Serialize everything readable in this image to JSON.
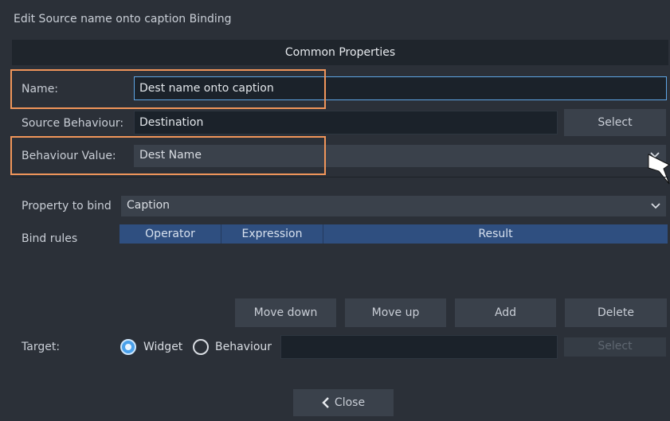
{
  "window": {
    "title": "Edit Source name onto caption Binding"
  },
  "section": {
    "title": "Common Properties"
  },
  "name": {
    "label": "Name:",
    "value": "Dest name onto caption"
  },
  "source_behaviour": {
    "label": "Source Behaviour:",
    "value": "Destination",
    "select_label": "Select"
  },
  "behaviour_value": {
    "label": "Behaviour Value:",
    "value": "Dest Name"
  },
  "property_to_bind": {
    "label": "Property to bind",
    "value": "Caption"
  },
  "bind_rules": {
    "label": "Bind rules",
    "columns": [
      "Operator",
      "Expression",
      "Result"
    ],
    "rows": []
  },
  "actions": {
    "move_down": "Move down",
    "move_up": "Move up",
    "add": "Add",
    "delete": "Delete"
  },
  "target": {
    "label": "Target:",
    "options": [
      "Widget",
      "Behaviour"
    ],
    "selected": "Widget",
    "value": "",
    "select_label": "Select"
  },
  "footer": {
    "close_label": "Close"
  },
  "colors": {
    "background": "#2b3038",
    "header_blue": "#2f4f80",
    "highlight": "#f0955a",
    "focus": "#5ea6e6",
    "radio_on": "#4aa0ea"
  }
}
